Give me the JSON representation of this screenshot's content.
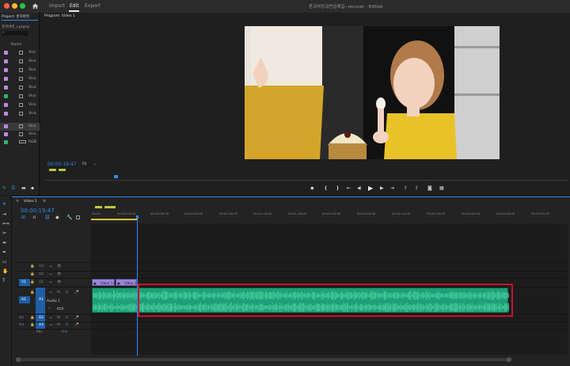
{
  "menu": {
    "import": "Import",
    "edit": "Edit",
    "export": "Export"
  },
  "window_title": "혼코바킹과연습제일--recover - Edited",
  "project": {
    "tab": "Project: 혼코바킹",
    "file": "혼코바킹_r.prproj",
    "column_name": "Name",
    "items": [
      {
        "label": "Amr",
        "color": "#b88be0"
      },
      {
        "label": "Vico",
        "color": "#b88be0"
      },
      {
        "label": "Vico",
        "color": "#b88be0"
      },
      {
        "label": "Vico",
        "color": "#b88be0"
      },
      {
        "label": "Vico",
        "color": "#b88be0"
      },
      {
        "label": "Vico",
        "color": "#2bb673"
      },
      {
        "label": "Vico",
        "color": "#b88be0"
      },
      {
        "label": "Vico",
        "color": "#b88be0"
      },
      {
        "label": "Vico",
        "color": "#b88be0"
      },
      {
        "label": "Vico",
        "color": "#b88be0"
      },
      {
        "label": "RGB",
        "color": "#2bb673"
      }
    ]
  },
  "program": {
    "tab": "Program: Video 1",
    "timecode": "00:00:19:47",
    "fit": "Fit"
  },
  "timeline": {
    "sequence_tab": "Video 1",
    "timecode": "00:00:19:47",
    "ruler": [
      "00:00",
      "00:00:15:00",
      "00:00:30:00",
      "00:00:45:00",
      "00:01:00:00",
      "00:01:15:00",
      "00:01:30:00",
      "00:01:45:00",
      "00:02:00:00",
      "00:02:15:00",
      "00:02:30:00",
      "00:02:45:00",
      "00:03:00:00",
      "00:03:15:00"
    ],
    "tracks": {
      "v3": "V3",
      "v2": "V2",
      "v1": "V1",
      "v1_src": "V1",
      "a1": "A1",
      "a1_src": "A1",
      "a2": "A2",
      "a2_src": "A2",
      "a3": "A3",
      "a3_src": "A3",
      "audio_label": "Audio 1",
      "mix_label": "Mix",
      "mix_value": "0.0"
    },
    "clips": {
      "video_clip_1": "Video 7.m",
      "video_clip_2": "Video 3"
    }
  },
  "colors": {
    "accent": "#2d8ceb",
    "audio_clip": "#1f9e77",
    "audio_wave": "#49d6a2",
    "video_clip": "#9b87d6",
    "highlight": "#c8102e"
  }
}
